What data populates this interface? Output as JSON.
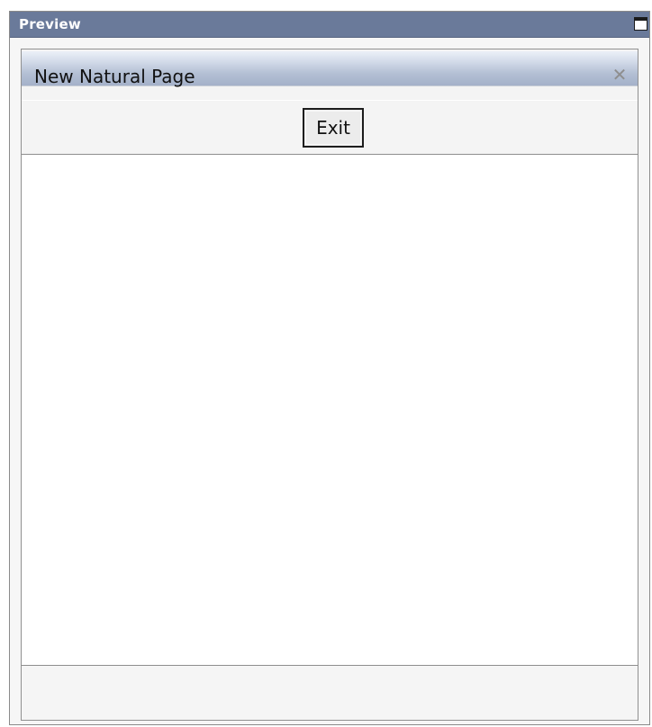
{
  "preview_panel": {
    "title": "Preview",
    "maximize_icon": "maximize-icon"
  },
  "page": {
    "title": "New Natural Page",
    "close_icon": "close-icon",
    "close_glyph": "✕"
  },
  "toolbar": {
    "exit_label": "Exit"
  },
  "colors": {
    "header_bg": "#6a7a9a",
    "title_strip_gradient_top": "#ebf0f8",
    "title_strip_gradient_bottom": "#a4b1c9",
    "panel_bg": "#f4f4f4"
  }
}
